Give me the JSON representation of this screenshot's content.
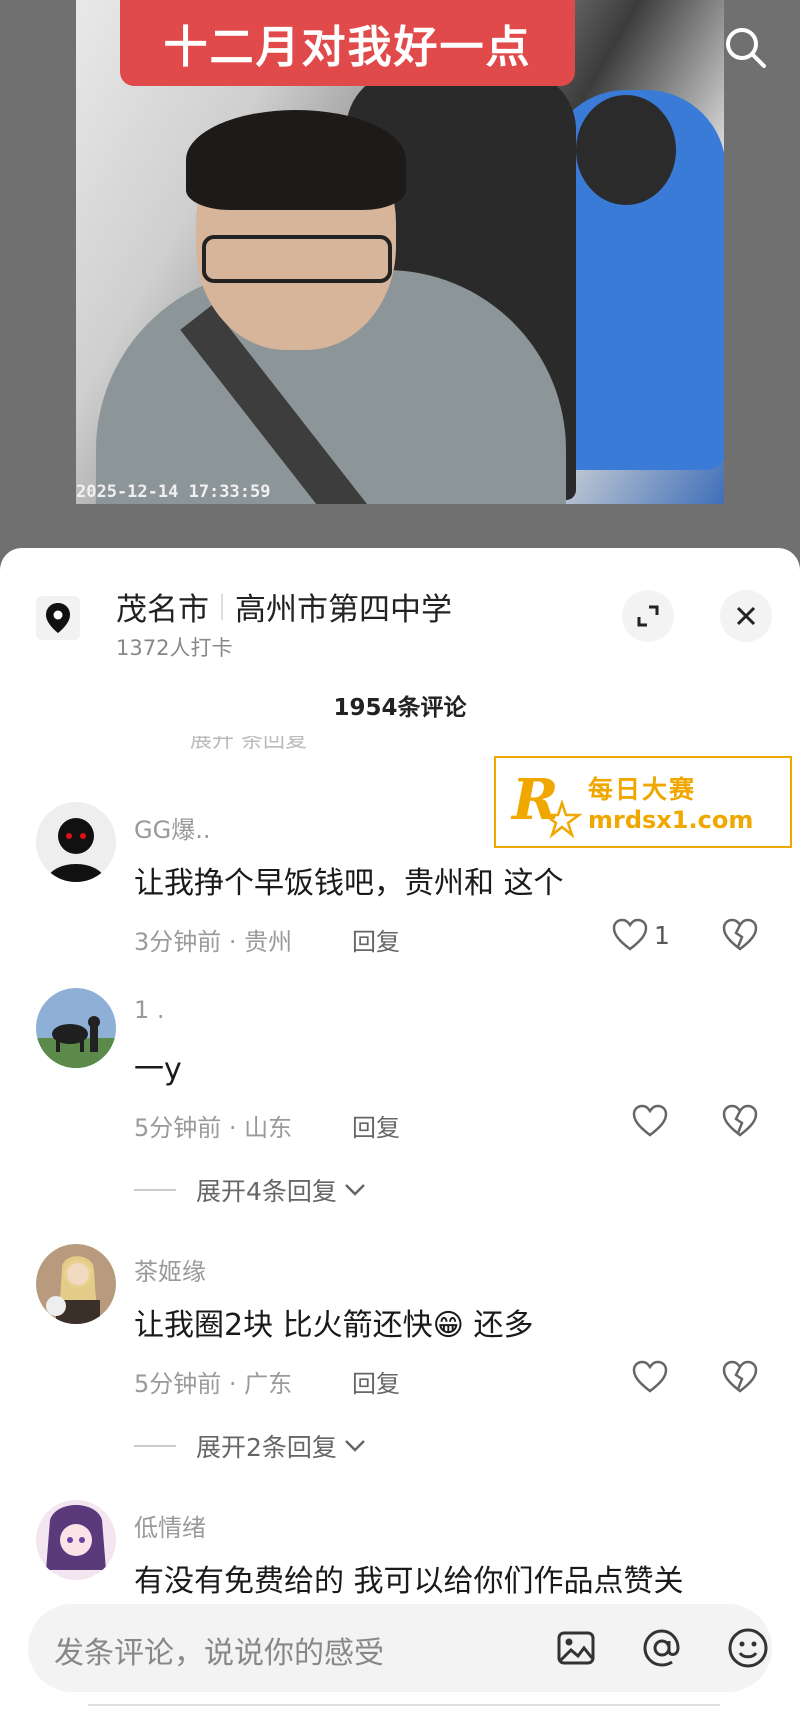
{
  "video": {
    "banner_text": "十二月对我好一点",
    "timestamp": "2025-12-14   17:33:59",
    "search_icon": "search-icon"
  },
  "location": {
    "city": "茂名市",
    "place": "高州市第四中学",
    "checkins": "1372人打卡",
    "icon": "location-pin-icon"
  },
  "comments_header": {
    "count": "1954条评论"
  },
  "ad": {
    "logo_letter": "R",
    "line1": "每日大赛",
    "line2": "mrdsx1.com"
  },
  "comments": [
    {
      "user": "GG爆..",
      "text": "让我挣个早饭钱吧，贵州和 这个",
      "meta": "3分钟前 · 贵州",
      "reply": "回复",
      "likes": "1"
    },
    {
      "user": "1 .",
      "text": "一y",
      "meta": "5分钟前 · 山东",
      "reply": "回复",
      "likes": "",
      "expand": "展开4条回复"
    },
    {
      "user": "茶姬缘",
      "text": "让我圈2块 比火箭还快",
      "text_tail": " 还多",
      "emoji": "😁",
      "meta": "5分钟前 · 广东",
      "reply": "回复",
      "likes": "",
      "expand": "展开2条回复"
    },
    {
      "user": "低情绪",
      "text": "有没有免费给的 我可以给你们作品点赞关"
    }
  ],
  "input": {
    "placeholder": "发条评论，说说你的感受"
  },
  "colors": {
    "banner": "#e14a4a",
    "ad_accent": "#f0a800",
    "muted_text": "#9a9a9a"
  }
}
